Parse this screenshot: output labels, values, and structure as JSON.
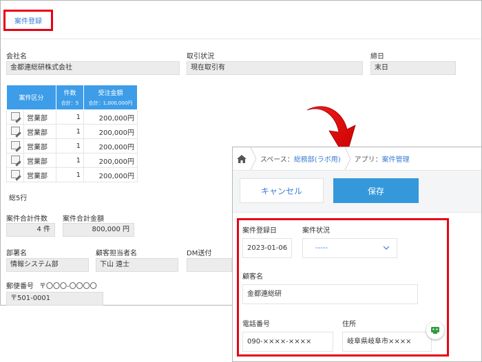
{
  "background": {
    "tab_label": "案件登録",
    "company_label": "会社名",
    "company_value": "金都連総研株式会社",
    "status_label": "取引状況",
    "status_value": "現在取引有",
    "deadline_label": "締日",
    "deadline_value": "末日",
    "table": {
      "headers": {
        "dept": "案件区分",
        "count": "件数",
        "count_sub": "合計：5",
        "amount": "受注金額",
        "amount_sub": "合計：1,000,000円"
      },
      "rows": [
        {
          "dept": "営業部",
          "count": "1",
          "amount": "200,000円"
        },
        {
          "dept": "営業部",
          "count": "1",
          "amount": "200,000円"
        },
        {
          "dept": "営業部",
          "count": "1",
          "amount": "200,000円"
        },
        {
          "dept": "営業部",
          "count": "1",
          "amount": "200,000円"
        },
        {
          "dept": "営業部",
          "count": "1",
          "amount": "200,000円"
        }
      ],
      "total_rows": "総5行"
    },
    "total_count_label": "案件合計件数",
    "total_count_value": "4 件",
    "total_amount_label": "案件合計金額",
    "total_amount_value": "800,000 円",
    "dept_label": "部署名",
    "dept_value": "情報システム部",
    "contact_label": "顧客担当者名",
    "contact_value": "下山 遠士",
    "dm_label": "DM送付",
    "postal_label": "郵便番号",
    "postal_hint": "〒〇〇〇-〇〇〇〇",
    "postal_value": "〒501-0001"
  },
  "foreground": {
    "breadcrumb": {
      "space_prefix": "スペース：",
      "space_name": "総務部(ラボ用)",
      "app_prefix": "アプリ：",
      "app_name": "案件管理"
    },
    "cancel_label": "キャンセル",
    "save_label": "保存",
    "form": {
      "reg_date_label": "案件登録日",
      "reg_date_value": "2023-01-06",
      "case_status_label": "案件状況",
      "case_status_value": "-----",
      "customer_label": "顧客名",
      "customer_value": "金都連総研",
      "phone_label": "電話番号",
      "phone_value": "090-××××-××××",
      "address_label": "住所",
      "address_value": "岐阜県岐阜市××××"
    }
  },
  "colors": {
    "accent_red": "#e60012",
    "link_blue": "#3a7bd5",
    "save_blue": "#3498db",
    "table_header_blue": "#3d9de8"
  },
  "icons": [
    "home-icon",
    "edit-icon",
    "chevron-down-icon",
    "chat-icon",
    "arrow-icon"
  ]
}
